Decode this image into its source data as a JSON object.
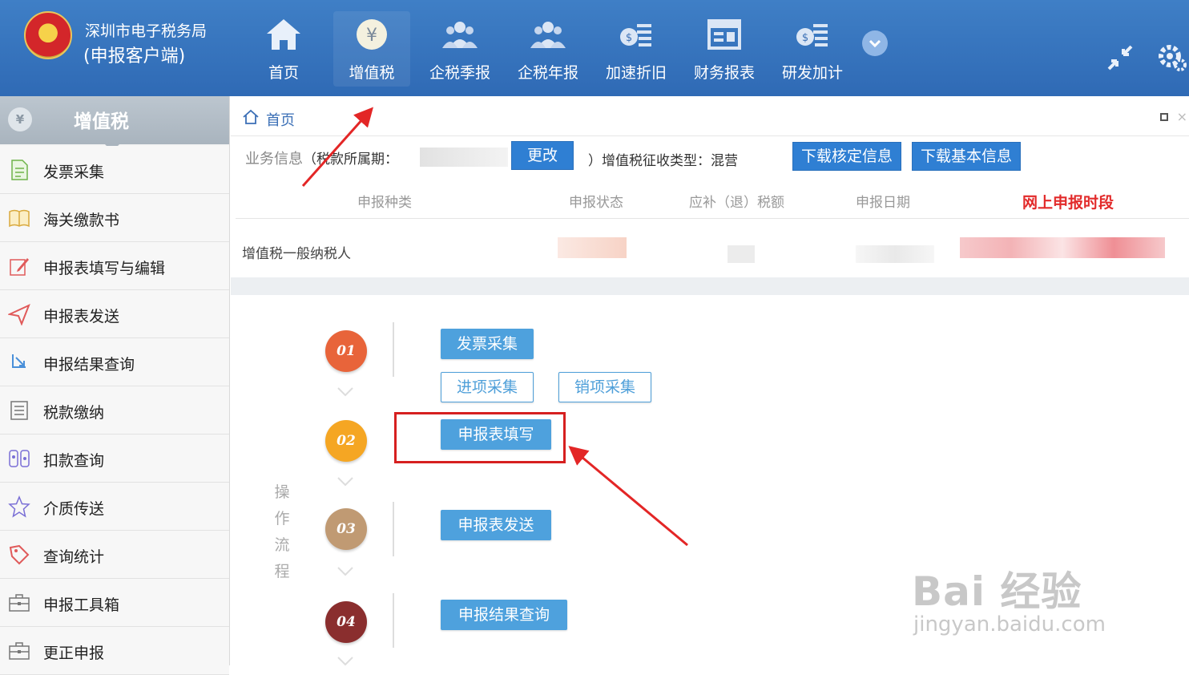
{
  "header": {
    "org_name": "深圳市电子税务局",
    "client_name": "(申报客户端)",
    "nav": [
      {
        "label": "首页",
        "icon": "home-icon"
      },
      {
        "label": "增值税",
        "icon": "yuan-icon"
      },
      {
        "label": "企税季报",
        "icon": "users-icon"
      },
      {
        "label": "企税年报",
        "icon": "users-icon"
      },
      {
        "label": "加速折旧",
        "icon": "money-list-icon"
      },
      {
        "label": "财务报表",
        "icon": "report-icon"
      },
      {
        "label": "研发加计",
        "icon": "money-list-icon"
      }
    ],
    "active_nav": "增值税"
  },
  "sidebar": {
    "title": "增值税",
    "items": [
      {
        "label": "发票采集",
        "icon": "document-icon"
      },
      {
        "label": "海关缴款书",
        "icon": "book-icon"
      },
      {
        "label": "申报表填写与编辑",
        "icon": "edit-icon"
      },
      {
        "label": "申报表发送",
        "icon": "send-icon"
      },
      {
        "label": "申报结果查询",
        "icon": "search-result-icon"
      },
      {
        "label": "税款缴纳",
        "icon": "list-icon"
      },
      {
        "label": "扣款查询",
        "icon": "deduction-icon"
      },
      {
        "label": "介质传送",
        "icon": "star-icon"
      },
      {
        "label": "查询统计",
        "icon": "tag-icon"
      },
      {
        "label": "申报工具箱",
        "icon": "toolbox-icon"
      },
      {
        "label": "更正申报",
        "icon": "toolbox-icon"
      }
    ]
  },
  "main": {
    "breadcrumb": "首页",
    "biz_info_label": "业务信息",
    "tax_period_label": "（税款所属期：",
    "change_button": "更改",
    "vat_type_text": "）增值税征收类型：混营",
    "download_verified_button": "下载核定信息",
    "download_basic_button": "下载基本信息",
    "table": {
      "columns": [
        "申报种类",
        "申报状态",
        "应补（退）税额",
        "申报日期",
        "网上申报时段"
      ],
      "rows": [
        {
          "type": "增值税一般纳税人"
        }
      ]
    },
    "flow": {
      "side_label": [
        "操",
        "作",
        "流",
        "程"
      ],
      "steps": [
        {
          "number": "01",
          "color": "#e8643a",
          "buttons": [
            "发票采集"
          ],
          "sub_buttons": [
            "进项采集",
            "销项采集"
          ]
        },
        {
          "number": "02",
          "color": "#f5a623",
          "buttons": [
            "申报表填写"
          ]
        },
        {
          "number": "03",
          "color": "#c09a73",
          "buttons": [
            "申报表发送"
          ]
        },
        {
          "number": "04",
          "color": "#8a2e2e",
          "buttons": [
            "申报结果查询"
          ]
        }
      ]
    }
  },
  "watermark": {
    "brand": "Bai 经验",
    "url": "jingyan.baidu.com"
  },
  "colors": {
    "topbar": "#3775c0",
    "accent": "#2f7fd3",
    "flow_button": "#4ea1dd",
    "highlight": "#d62020"
  }
}
